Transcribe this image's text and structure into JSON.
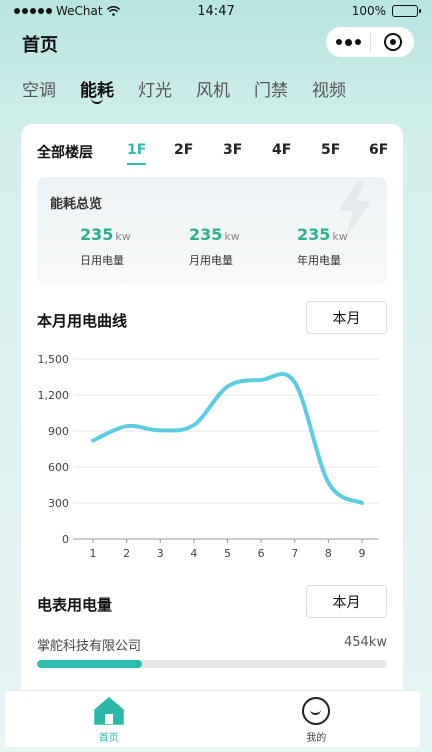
{
  "status_bar": {
    "carrier": "WeChat",
    "time": "14:47",
    "battery": "100%"
  },
  "nav": {
    "title": "首页"
  },
  "category_tabs": [
    {
      "label": "空调",
      "active": false
    },
    {
      "label": "能耗",
      "active": true
    },
    {
      "label": "灯光",
      "active": false
    },
    {
      "label": "风机",
      "active": false
    },
    {
      "label": "门禁",
      "active": false
    },
    {
      "label": "视频",
      "active": false
    }
  ],
  "floor_filter": {
    "label": "全部楼层",
    "floors": [
      {
        "label": "1F",
        "active": true
      },
      {
        "label": "2F",
        "active": false
      },
      {
        "label": "3F",
        "active": false
      },
      {
        "label": "4F",
        "active": false
      },
      {
        "label": "5F",
        "active": false
      },
      {
        "label": "6F",
        "active": false
      }
    ]
  },
  "overview": {
    "title": "能耗总览",
    "stats": [
      {
        "value": "235",
        "unit": "kw",
        "label": "日用电量"
      },
      {
        "value": "235",
        "unit": "kw",
        "label": "月用电量"
      },
      {
        "value": "235",
        "unit": "kw",
        "label": "年用电量"
      }
    ]
  },
  "curve_section": {
    "title": "本月用电曲线",
    "period_button": "本月"
  },
  "chart_data": {
    "type": "line",
    "x": [
      1,
      2,
      3,
      4,
      5,
      6,
      7,
      8,
      9
    ],
    "series": [
      {
        "values": [
          820,
          940,
          905,
          950,
          1270,
          1325,
          1305,
          470,
          300
        ]
      }
    ],
    "ylim": [
      0,
      1500
    ],
    "yticks": [
      0,
      300,
      600,
      900,
      1200,
      1500
    ],
    "ytick_labels": [
      "0",
      "300",
      "600",
      "900",
      "1,200",
      "1,500"
    ],
    "grid": true,
    "color": "#5ccde0"
  },
  "meter_section": {
    "title": "电表用电量",
    "period_button": "本月"
  },
  "meters": [
    {
      "name": "掌舵科技有限公司",
      "value": "454kw",
      "ratio": 0.3
    }
  ],
  "tabbar": [
    {
      "label": "首页",
      "icon": "home-icon",
      "active": true
    },
    {
      "label": "我的",
      "icon": "profile-icon",
      "active": false
    }
  ],
  "colors": {
    "accent": "#2bbfa9",
    "stat_value": "#2bb08e",
    "line": "#5ccde0"
  }
}
